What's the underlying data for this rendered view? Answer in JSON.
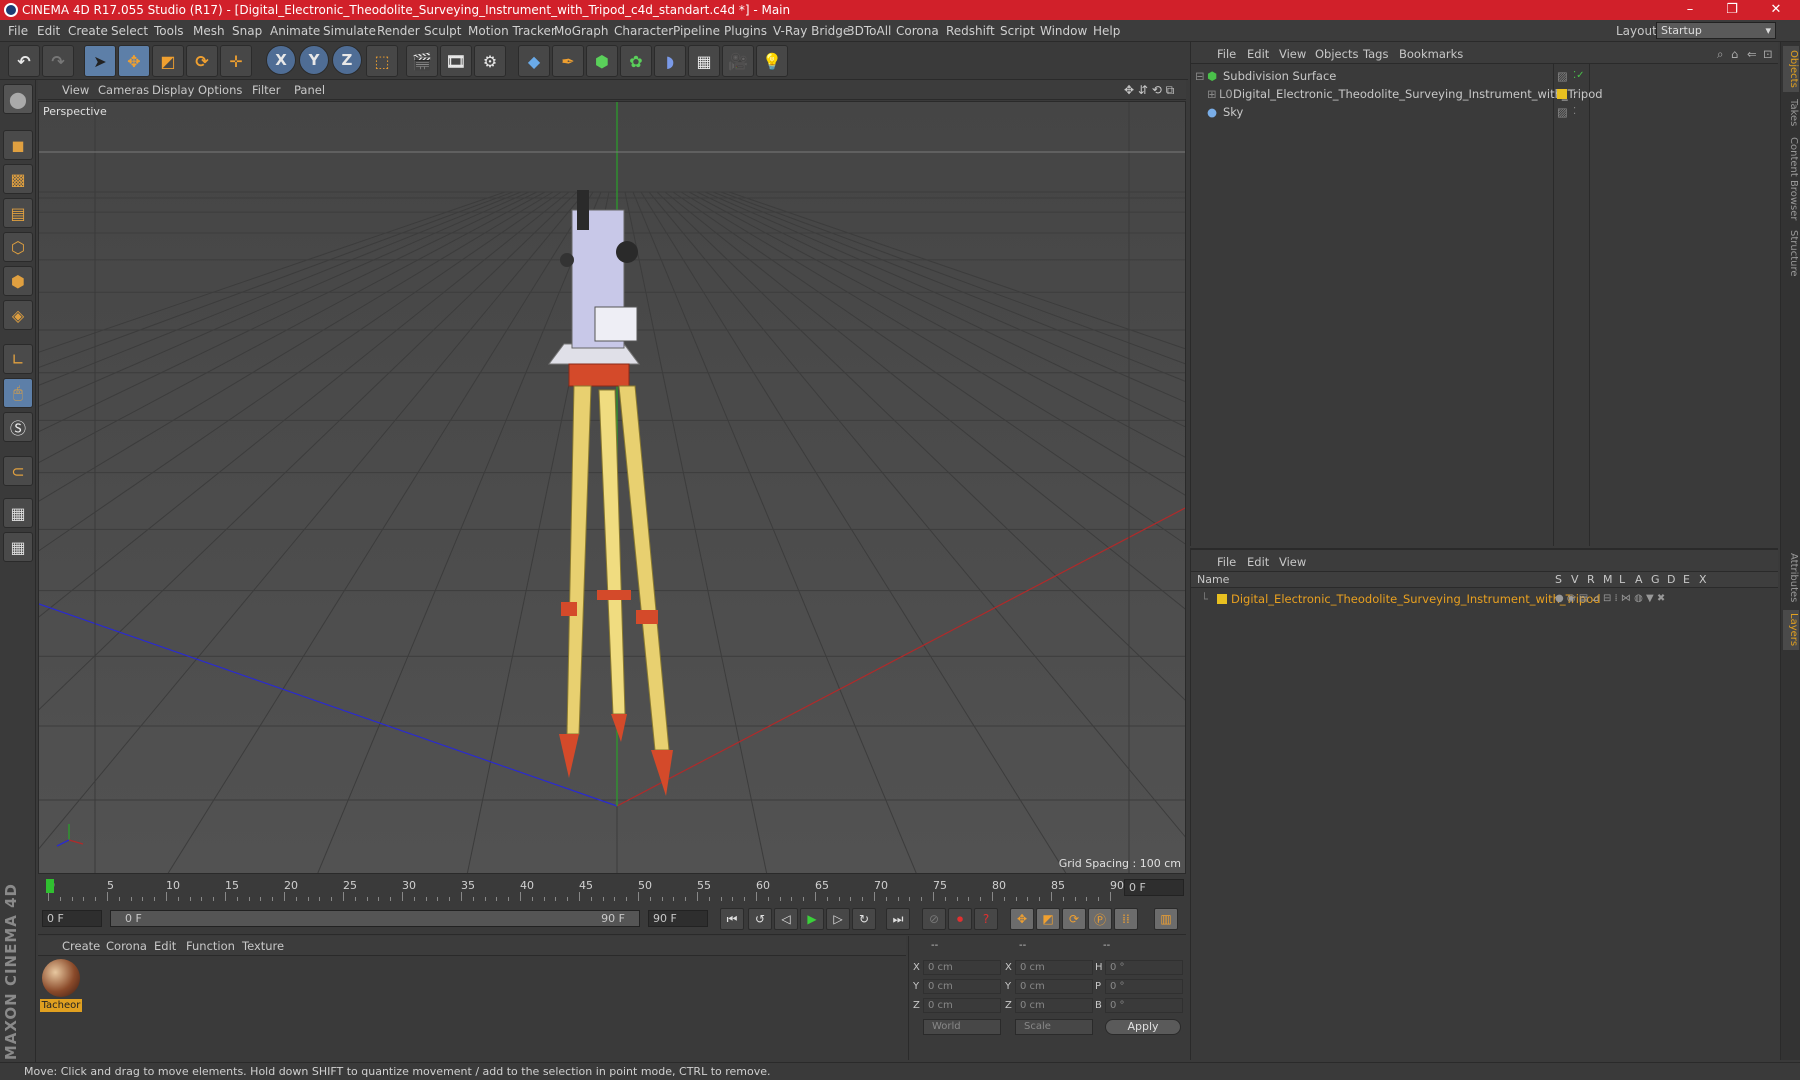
{
  "window": {
    "title": "CINEMA 4D R17.055 Studio (R17) - [Digital_Electronic_Theodolite_Surveying_Instrument_with_Tripod_c4d_standart.c4d *] - Main",
    "minimize": "–",
    "maximize": "❐",
    "close": "✕"
  },
  "menu": [
    "File",
    "Edit",
    "Create",
    "Select",
    "Tools",
    "Mesh",
    "Snap",
    "Animate",
    "Simulate",
    "Render",
    "Sculpt",
    "Motion Tracker",
    "MoGraph",
    "Character",
    "Pipeline",
    "Plugins",
    "V-Ray Bridge",
    "3DToAll",
    "Corona",
    "Redshift",
    "Script",
    "Window",
    "Help"
  ],
  "layout": {
    "label": "Layout:",
    "value": "Startup"
  },
  "toolbar": {
    "x": "X",
    "y": "Y",
    "z": "Z"
  },
  "viewport": {
    "menu": [
      "View",
      "Cameras",
      "Display",
      "Options",
      "Filter",
      "Panel"
    ],
    "label": "Perspective",
    "grid_spacing": "Grid Spacing : 100 cm"
  },
  "timeline": {
    "ticks": [
      "0",
      "5",
      "10",
      "15",
      "20",
      "25",
      "30",
      "35",
      "40",
      "45",
      "50",
      "55",
      "60",
      "65",
      "70",
      "75",
      "80",
      "85",
      "90"
    ],
    "current_frame": "0 F"
  },
  "transport": {
    "start_field": "0 F",
    "range_start": "0 F",
    "range_end": "90 F",
    "end_field": "90 F"
  },
  "material_manager": {
    "menu": [
      "Create",
      "Corona",
      "Edit",
      "Function",
      "Texture"
    ],
    "material_name": "Tacheor"
  },
  "coordinates": {
    "headers": [
      "--",
      "--",
      "--"
    ],
    "rows": [
      {
        "l1": "X",
        "v1": "0 cm",
        "l2": "X",
        "v2": "0 cm",
        "l3": "H",
        "v3": "0 °"
      },
      {
        "l1": "Y",
        "v1": "0 cm",
        "l2": "Y",
        "v2": "0 cm",
        "l3": "P",
        "v3": "0 °"
      },
      {
        "l1": "Z",
        "v1": "0 cm",
        "l2": "Z",
        "v2": "0 cm",
        "l3": "B",
        "v3": "0 °"
      }
    ],
    "world": "World",
    "scale": "Scale",
    "apply": "Apply"
  },
  "object_manager": {
    "menu": [
      "File",
      "Edit",
      "View",
      "Objects",
      "Tags",
      "Bookmarks"
    ],
    "objects": [
      {
        "name": "Subdivision Surface"
      },
      {
        "name": "Digital_Electronic_Theodolite_Surveying_Instrument_with_Tripod"
      },
      {
        "name": "Sky"
      }
    ]
  },
  "layer_manager": {
    "menu": [
      "File",
      "Edit",
      "View"
    ],
    "name_header": "Name",
    "columns": [
      "S",
      "V",
      "R",
      "M",
      "L",
      "A",
      "G",
      "D",
      "E",
      "X"
    ],
    "layers": [
      {
        "name": "Digital_Electronic_Theodolite_Surveying_Instrument_with_Tripod",
        "color": "#e8c020"
      }
    ]
  },
  "right_tabs": [
    "Objects",
    "Takes",
    "Content Browser",
    "Structure",
    "Attributes",
    "Layers"
  ],
  "branding": {
    "logo": "MAXON CINEMA 4D"
  },
  "status": "Move: Click and drag to move elements. Hold down SHIFT to quantize movement / add to the selection in point mode, CTRL to remove.",
  "colors": {
    "title_bar": "#d1202a",
    "accent": "#e0a020",
    "tripod_leg": "#e8d070",
    "tripod_red": "#d44a2a"
  }
}
